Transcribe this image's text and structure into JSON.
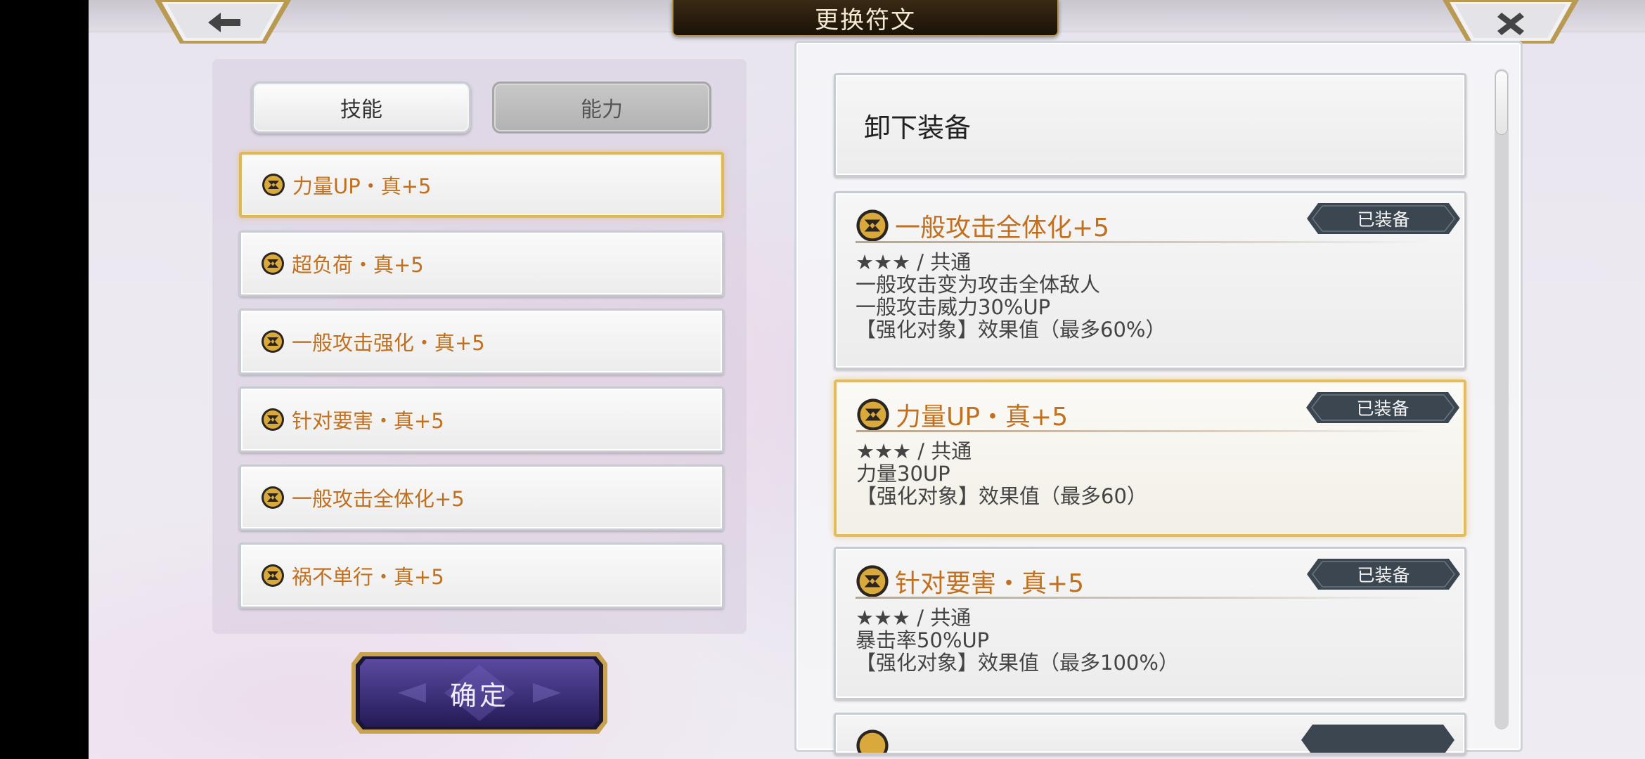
{
  "title": "更换符文",
  "colors": {
    "accent_gold": "#e0b85c",
    "rune_orange": "#c0701e",
    "badge_dark": "#3c4650",
    "confirm_purple": "#3b2e78"
  },
  "nav": {
    "back_icon": "arrow-left-icon",
    "close_icon": "close-icon"
  },
  "tabs": [
    {
      "label": "技能",
      "active": true
    },
    {
      "label": "能力",
      "active": false
    }
  ],
  "rune_list": [
    {
      "label": "力量UP・真+5",
      "selected": true
    },
    {
      "label": "超负荷・真+5",
      "selected": false
    },
    {
      "label": "一般攻击强化・真+5",
      "selected": false
    },
    {
      "label": "针对要害・真+5",
      "selected": false
    },
    {
      "label": "一般攻击全体化+5",
      "selected": false
    },
    {
      "label": "祸不单行・真+5",
      "selected": false
    }
  ],
  "confirm_label": "确定",
  "unequip_label": "卸下装备",
  "details": [
    {
      "name": "一般攻击全体化+5",
      "badge": "已装备",
      "lines": [
        "★★★ / 共通",
        "一般攻击变为攻击全体敌人",
        "一般攻击威力30%UP",
        "【强化对象】效果值（最多60%）"
      ],
      "selected": false
    },
    {
      "name": "力量UP・真+5",
      "badge": "已装备",
      "lines": [
        "★★★ / 共通",
        "力量30UP",
        "【强化对象】效果值（最多60）"
      ],
      "selected": true
    },
    {
      "name": "针对要害・真+5",
      "badge": "已装备",
      "lines": [
        "★★★ / 共通",
        "暴击率50%UP",
        "【强化对象】效果值（最多100%）"
      ],
      "selected": false
    }
  ]
}
